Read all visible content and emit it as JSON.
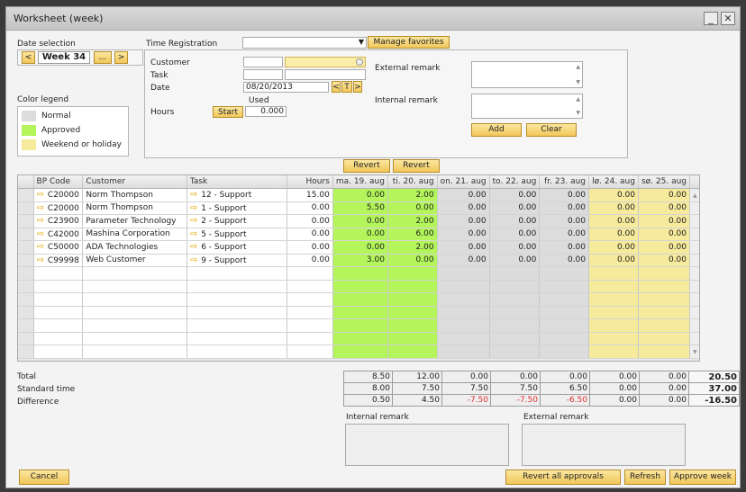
{
  "window": {
    "title": "Worksheet (week)",
    "min": "_",
    "close": "✕"
  },
  "date_selection": {
    "label": "Date selection",
    "prev": "<",
    "week": "Week 34",
    "more": "...",
    "next": ">"
  },
  "time_registration": {
    "label": "Time Registration",
    "value": "",
    "dropdown_arrow": "▼",
    "manage_favorites": "Manage favorites"
  },
  "legend": {
    "label": "Color legend",
    "items": [
      {
        "label": "Normal",
        "color": "#dcdcdc"
      },
      {
        "label": "Approved",
        "color": "#b3f55a"
      },
      {
        "label": "Weekend or holiday",
        "color": "#f6ea9c"
      }
    ]
  },
  "form": {
    "customer_label": "Customer",
    "customer_code": "",
    "customer_name": "",
    "task_label": "Task",
    "task_code": "",
    "task_name": "",
    "date_label": "Date",
    "date_value": "08/20/2013",
    "date_prev": "<",
    "date_today": "T",
    "date_next": ">",
    "used_label": "Used",
    "hours_label": "Hours",
    "start_button": "Start",
    "hours_value": "0.000",
    "external_remark_label": "External remark",
    "internal_remark_label": "Internal remark",
    "add_button": "Add",
    "clear_button": "Clear"
  },
  "revert_buttons": [
    "Revert",
    "Revert"
  ],
  "grid": {
    "columns": [
      "BP Code",
      "Customer",
      "Task",
      "Hours",
      "ma. 19. aug",
      "ti. 20. aug",
      "on. 21. aug",
      "to. 22. aug",
      "fr. 23. aug",
      "lø. 24. aug",
      "sø. 25. aug"
    ],
    "rows": [
      {
        "bp": "C20000",
        "customer": "Norm Thompson",
        "task": "12 - Support",
        "hours": "15.00",
        "d": [
          "0.00",
          "2.00",
          "0.00",
          "0.00",
          "0.00",
          "0.00",
          "0.00"
        ]
      },
      {
        "bp": "C20000",
        "customer": "Norm Thompson",
        "task": "1 - Support",
        "hours": "0.00",
        "d": [
          "5.50",
          "0.00",
          "0.00",
          "0.00",
          "0.00",
          "0.00",
          "0.00"
        ]
      },
      {
        "bp": "C23900",
        "customer": "Parameter Technology",
        "task": "2 - Support",
        "hours": "0.00",
        "d": [
          "0.00",
          "2.00",
          "0.00",
          "0.00",
          "0.00",
          "0.00",
          "0.00"
        ]
      },
      {
        "bp": "C42000",
        "customer": "Mashina Corporation",
        "task": "5 - Support",
        "hours": "0.00",
        "d": [
          "0.00",
          "6.00",
          "0.00",
          "0.00",
          "0.00",
          "0.00",
          "0.00"
        ]
      },
      {
        "bp": "C50000",
        "customer": "ADA Technologies",
        "task": "6 - Support",
        "hours": "0.00",
        "d": [
          "0.00",
          "2.00",
          "0.00",
          "0.00",
          "0.00",
          "0.00",
          "0.00"
        ]
      },
      {
        "bp": "C99998",
        "customer": "Web Customer",
        "task": "9 - Support",
        "hours": "0.00",
        "d": [
          "3.00",
          "0.00",
          "0.00",
          "0.00",
          "0.00",
          "0.00",
          "0.00"
        ]
      }
    ],
    "row_arrow": "⇨",
    "empty_rows": 7
  },
  "totals": {
    "total": {
      "label": "Total",
      "values": [
        "8.50",
        "12.00",
        "0.00",
        "0.00",
        "0.00",
        "0.00",
        "0.00"
      ],
      "sum": "20.50"
    },
    "standard": {
      "label": "Standard time",
      "values": [
        "8.00",
        "7.50",
        "7.50",
        "7.50",
        "6.50",
        "0.00",
        "0.00"
      ],
      "sum": "37.00"
    },
    "difference": {
      "label": "Difference",
      "values": [
        "0.50",
        "4.50",
        "-7.50",
        "-7.50",
        "-6.50",
        "0.00",
        "0.00"
      ],
      "sum": "-16.50"
    }
  },
  "bottom_remarks": {
    "internal_label": "Internal remark",
    "external_label": "External remark",
    "internal_value": "",
    "external_value": ""
  },
  "footer": {
    "cancel": "Cancel",
    "revert_all": "Revert all approvals",
    "refresh": "Refresh",
    "approve_week": "Approve week"
  }
}
